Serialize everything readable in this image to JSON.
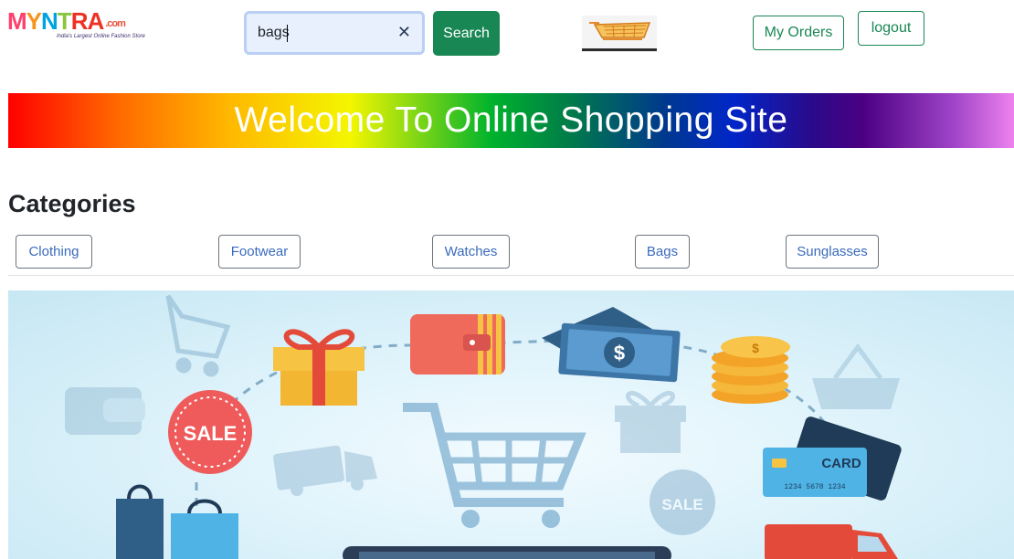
{
  "header": {
    "logo_text": "MYNTRA",
    "logo_suffix": ".com",
    "logo_tagline": "India's Largest Online Fashion Store",
    "search": {
      "value": "bags",
      "placeholder": ""
    },
    "search_label": "Search",
    "my_orders_label": "My Orders",
    "logout_label": "logout"
  },
  "banner": {
    "title": "Welcome To Online Shopping Site"
  },
  "categories": {
    "heading": "Categories",
    "items": [
      "Clothing",
      "Footwear",
      "Watches",
      "Bags",
      "Sunglasses"
    ]
  },
  "hero": {
    "sale_text_1": "SALE",
    "sale_text_2": "SALE",
    "card_label": "CARD",
    "card_number": "1234 5678 1234",
    "dollar_sign": "$",
    "coin_sign": "$"
  },
  "colors": {
    "primary_green": "#198754",
    "category_text": "#3a6bbd",
    "search_bg": "#e8f0fe"
  }
}
